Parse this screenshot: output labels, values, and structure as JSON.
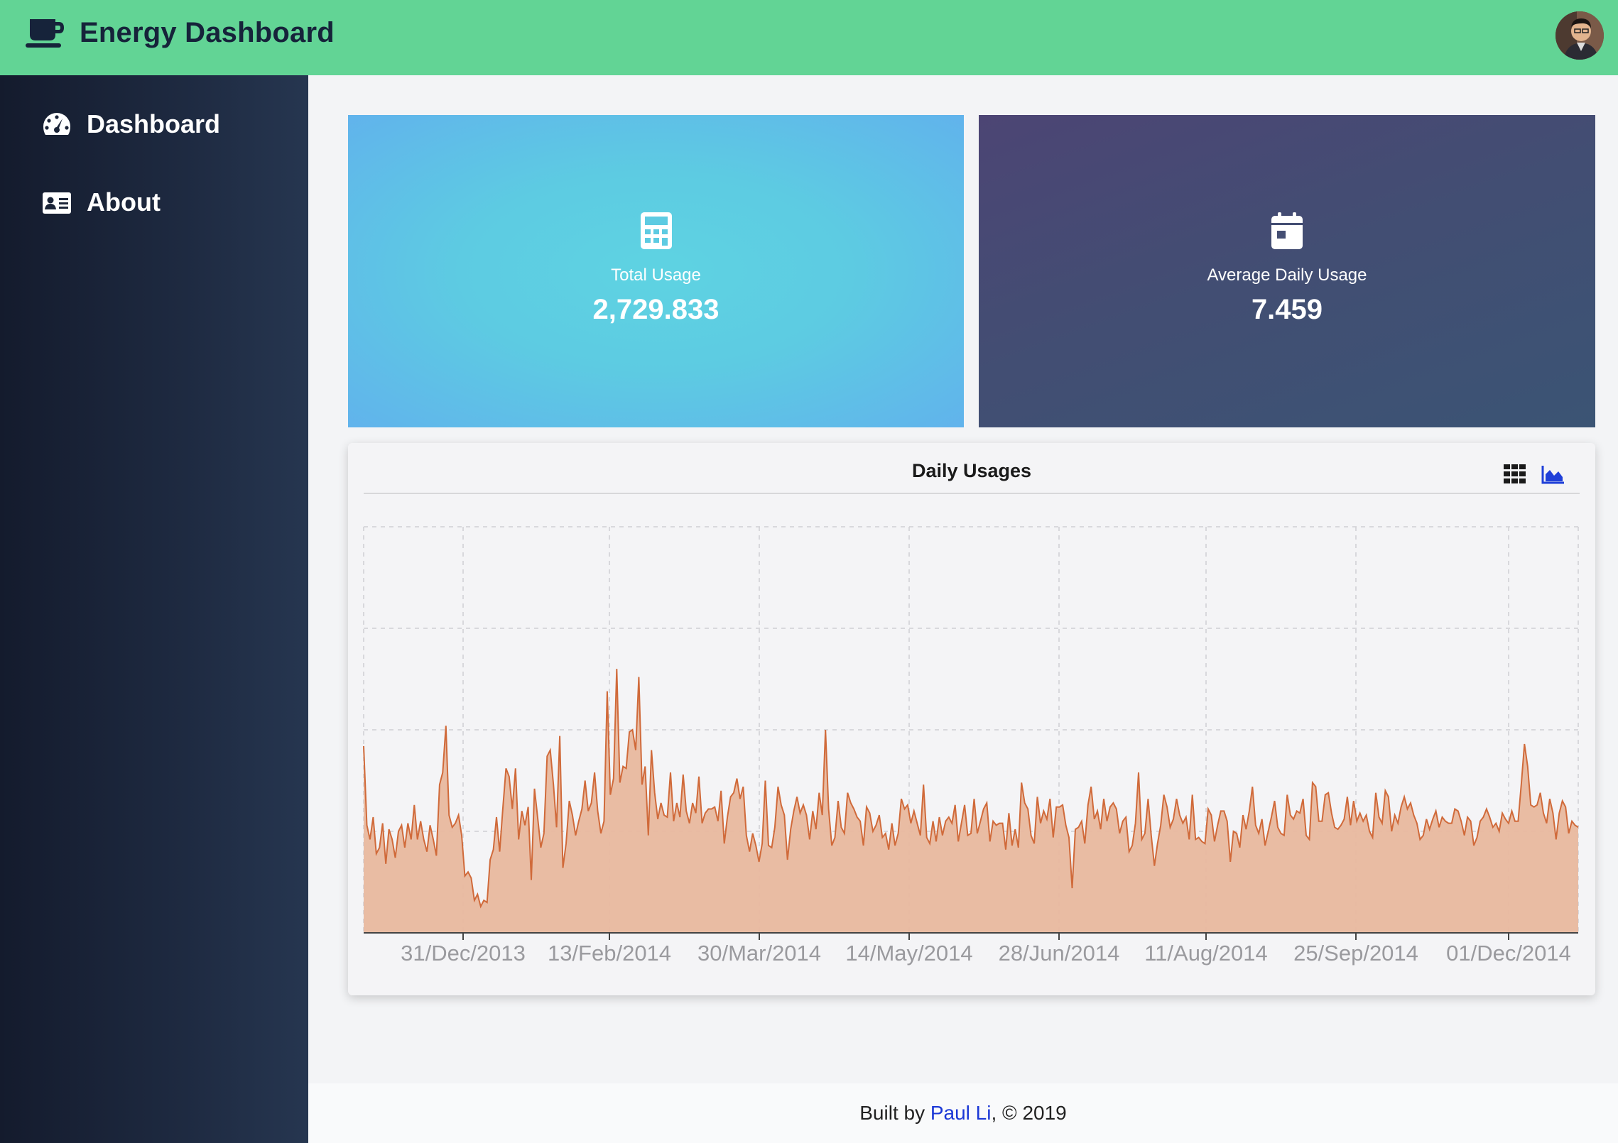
{
  "header": {
    "title": "Energy Dashboard",
    "brand_icon": "coffee-mug-icon",
    "color": "#62d495"
  },
  "sidebar": {
    "items": [
      {
        "label": "Dashboard",
        "icon": "speedometer-icon"
      },
      {
        "label": "About",
        "icon": "id-card-icon"
      }
    ]
  },
  "cards": [
    {
      "label": "Total Usage",
      "value": "2,729.833",
      "icon": "calculator-icon"
    },
    {
      "label": "Average Daily Usage",
      "value": "7.459",
      "icon": "calendar-icon"
    }
  ],
  "chart_panel": {
    "title": "Daily Usages",
    "tools": [
      "grid-view-icon",
      "area-chart-icon"
    ]
  },
  "chart_data": {
    "type": "area",
    "title": "Daily Usages",
    "x_tick_labels": [
      "31/Dec/2013",
      "13/Feb/2014",
      "30/Mar/2014",
      "14/May/2014",
      "28/Jun/2014",
      "11/Aug/2014",
      "25/Sep/2014",
      "01/Dec/2014"
    ],
    "ylim": [
      0,
      20
    ],
    "y_grid_step": 5,
    "grid": true,
    "fill_color": "#e8b89e",
    "line_color": "#d06a3a",
    "series": [
      {
        "values": [
          9.2,
          5.3,
          4.6,
          5.7,
          3.9,
          4.2,
          5.4,
          3.4,
          5.1,
          4.6,
          3.7,
          5.0,
          5.3,
          4.2,
          5.4,
          4.6,
          6.3,
          4.6,
          5.5,
          4.6,
          4.0,
          5.3,
          4.6,
          3.8,
          7.3,
          7.9,
          10.2,
          5.8,
          5.2,
          5.4,
          5.8,
          4.8,
          2.8,
          3.0,
          2.7,
          1.6,
          1.9,
          1.3,
          1.6,
          1.5,
          3.6,
          4.1,
          5.7,
          4.0,
          6.1,
          8.1,
          7.7,
          6.1,
          8.1,
          4.6,
          6.0,
          5.3,
          6.2,
          2.6,
          7.1,
          5.7,
          4.2,
          4.9,
          8.7,
          9.0,
          7.3,
          5.2,
          9.7,
          3.2,
          4.4,
          6.5,
          5.8,
          4.8,
          5.5,
          6.1,
          7.5,
          6.0,
          6.4,
          7.9,
          6.0,
          4.9,
          5.5,
          11.9,
          6.8,
          7.6,
          13.0,
          7.4,
          8.2,
          8.1,
          9.9,
          10.0,
          9.0,
          12.6,
          7.3,
          8.2,
          4.8,
          9.0,
          6.9,
          5.6,
          6.4,
          5.8,
          5.7,
          7.9,
          5.5,
          6.4,
          5.7,
          7.8,
          6.0,
          5.4,
          6.4,
          5.9,
          7.7,
          5.4,
          5.9,
          6.1,
          6.1,
          6.2,
          5.5,
          7.0,
          4.4,
          5.7,
          6.7,
          6.9,
          7.6,
          6.6,
          7.2,
          4.8,
          4.0,
          4.9,
          4.3,
          3.5,
          4.4,
          7.5,
          4.3,
          4.2,
          5.2,
          7.2,
          6.3,
          5.8,
          3.6,
          5.1,
          6.0,
          6.7,
          5.9,
          6.3,
          5.8,
          4.6,
          6.0,
          5.1,
          6.9,
          5.8,
          10.0,
          6.1,
          4.3,
          4.7,
          6.5,
          5.2,
          4.9,
          6.9,
          6.4,
          6.1,
          5.7,
          5.5,
          4.3,
          6.2,
          5.9,
          5.0,
          5.3,
          5.8,
          4.7,
          4.9,
          4.1,
          5.4,
          4.3,
          4.9,
          6.6,
          6.1,
          6.3,
          5.4,
          6.0,
          5.4,
          4.8,
          7.3,
          4.7,
          4.4,
          5.5,
          4.5,
          5.7,
          4.8,
          5.5,
          5.7,
          5.4,
          6.3,
          4.5,
          5.4,
          6.3,
          4.8,
          4.9,
          6.6,
          4.9,
          5.5,
          6.1,
          6.4,
          4.5,
          5.5,
          5.3,
          5.4,
          5.4,
          4.1,
          5.9,
          4.3,
          5.1,
          4.2,
          7.4,
          6.4,
          6.1,
          4.8,
          4.4,
          6.7,
          5.4,
          6.0,
          5.6,
          6.6,
          4.7,
          6.2,
          6.2,
          6.3,
          5.3,
          4.7,
          2.2,
          5.1,
          5.2,
          5.5,
          4.4,
          6.3,
          7.2,
          5.6,
          6.0,
          5.1,
          6.6,
          5.5,
          6.2,
          6.4,
          6.1,
          4.9,
          5.5,
          5.7,
          4.0,
          4.3,
          5.4,
          7.9,
          4.6,
          4.9,
          6.6,
          4.8,
          3.3,
          4.4,
          5.3,
          6.8,
          6.2,
          5.2,
          5.6,
          6.6,
          5.8,
          5.4,
          5.7,
          4.6,
          6.8,
          4.6,
          4.7,
          4.5,
          4.4,
          6.1,
          5.8,
          4.5,
          5.3,
          6.0,
          6.0,
          5.5,
          3.5,
          5.0,
          4.9,
          4.2,
          5.8,
          5.1,
          6.0,
          7.2,
          5.3,
          4.9,
          5.6,
          4.3,
          5.0,
          5.7,
          6.5,
          5.2,
          4.9,
          4.8,
          6.8,
          5.8,
          5.6,
          6.0,
          5.9,
          6.6,
          4.8,
          4.6,
          7.4,
          7.2,
          5.5,
          5.5,
          6.8,
          6.9,
          5.9,
          5.2,
          5.1,
          5.3,
          5.6,
          6.7,
          5.3,
          6.5,
          5.5,
          5.9,
          5.5,
          5.8,
          5.0,
          4.7,
          6.9,
          5.7,
          5.4,
          7.0,
          6.7,
          5.0,
          5.8,
          5.4,
          6.2,
          6.7,
          6.1,
          6.4,
          5.8,
          5.4,
          4.6,
          4.8,
          5.6,
          5.1,
          5.6,
          6.0,
          5.2,
          5.7,
          5.5,
          5.4,
          5.4,
          6.1,
          6.0,
          5.5,
          4.8,
          5.7,
          5.5,
          4.3,
          4.7,
          5.5,
          5.7,
          6.1,
          5.7,
          5.2,
          5.4,
          5.0,
          5.9,
          5.6,
          5.4,
          6.0,
          5.5,
          5.5,
          7.3,
          9.3,
          8.2,
          6.3,
          6.2,
          6.3,
          6.9,
          5.9,
          5.4,
          6.6,
          5.9,
          4.6,
          5.9,
          6.5,
          6.2,
          4.9,
          5.5,
          5.3,
          5.2
        ]
      }
    ]
  },
  "footer": {
    "prefix": "Built by ",
    "author": "Paul Li",
    "suffix": ", © 2019"
  }
}
